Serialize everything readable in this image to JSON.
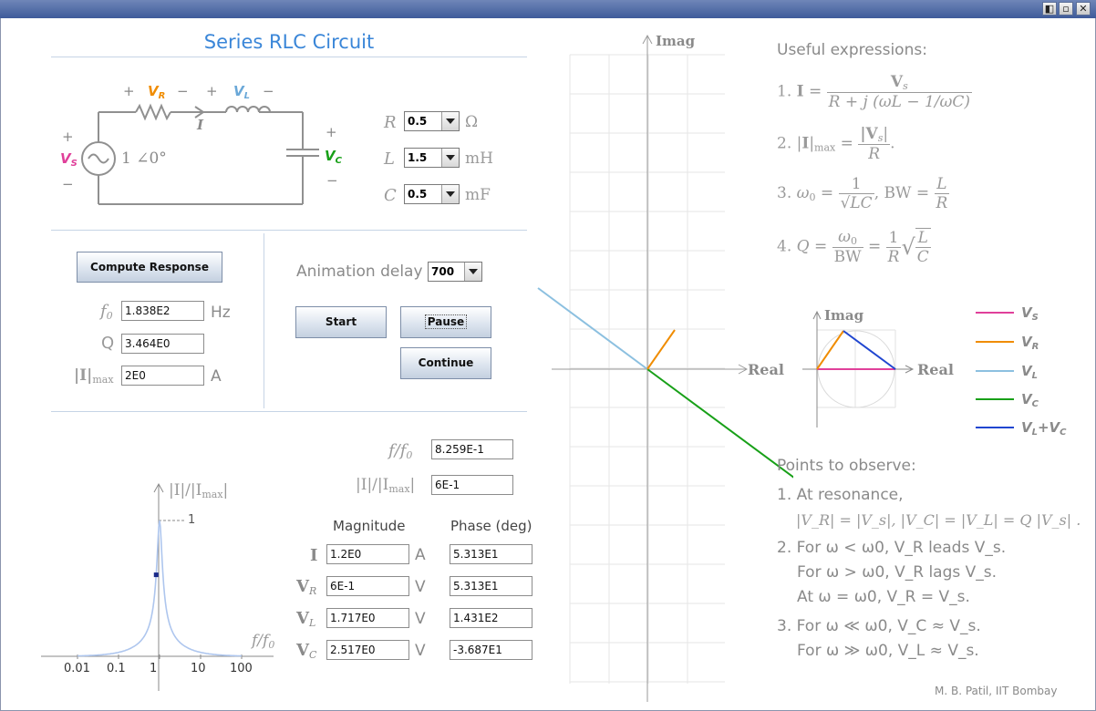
{
  "window": {
    "buttons": [
      "◧",
      "▫",
      "✕"
    ]
  },
  "app_title": "Series RLC Circuit",
  "circuit": {
    "source_value": "1 ∠0°",
    "current_label": "I",
    "plus": "+",
    "minus": "−",
    "vs_label": "V",
    "vs_sub": "S",
    "vr_label": "V",
    "vr_sub": "R",
    "vl_label": "V",
    "vl_sub": "L",
    "vc_label": "V",
    "vc_sub": "C",
    "colors": {
      "vs": "#e0409a",
      "vr": "#f08c00",
      "vl": "#6aa8d8",
      "vc": "#18a018",
      "vlvc": "#2046d0",
      "wire": "#909090"
    }
  },
  "params": {
    "r": {
      "label": "R",
      "value": "0.5",
      "unit": "Ω"
    },
    "l": {
      "label": "L",
      "value": "1.5",
      "unit": "mH"
    },
    "c": {
      "label": "C",
      "value": "0.5",
      "unit": "mF"
    }
  },
  "compute_button": "Compute Response",
  "results": {
    "f0": {
      "label": "f",
      "sub": "0",
      "value": "1.838E2",
      "unit": "Hz"
    },
    "q": {
      "label": "Q",
      "value": "3.464E0"
    },
    "imax": {
      "label": "|I|",
      "sub": "max",
      "value": "2E0",
      "unit": "A"
    }
  },
  "animation": {
    "label": "Animation delay",
    "delay": "700",
    "start": "Start",
    "pause": "Pause",
    "continue": "Continue"
  },
  "freq_plot": {
    "ylabel": "|I|/|I",
    "ylabel_sub": "max",
    "ylabel_end": "|",
    "xlabel": "f/f",
    "xlabel_sub": "0",
    "peak_label": "1",
    "ticks": [
      "0.01",
      "0.1",
      "1",
      "10",
      "100"
    ]
  },
  "chart_data": {
    "type": "line",
    "xlabel": "f/f0",
    "ylabel": "|I|/|Imax|",
    "x_scale": "log",
    "x_ticks": [
      0.01,
      0.1,
      1,
      10,
      100
    ],
    "peak": {
      "x": 1,
      "y": 1
    },
    "marker": {
      "x": 0.8259,
      "y": 0.6
    },
    "series": [
      {
        "values": [
          [
            0.01,
            0.01
          ],
          [
            0.1,
            0.03
          ],
          [
            0.3,
            0.07
          ],
          [
            0.6,
            0.15
          ],
          [
            0.8,
            0.5
          ],
          [
            1,
            1
          ],
          [
            1.25,
            0.5
          ],
          [
            1.7,
            0.15
          ],
          [
            3,
            0.07
          ],
          [
            10,
            0.03
          ],
          [
            100,
            0.01
          ]
        ]
      }
    ]
  },
  "point": {
    "f_ratio": {
      "label": "f/f",
      "sub": "0",
      "value": "8.259E-1"
    },
    "i_ratio": {
      "label": "|I|/|I",
      "sub": "max",
      "end": "|",
      "value": "6E-1"
    }
  },
  "table": {
    "col_mag": "Magnitude",
    "col_phase": "Phase (deg)",
    "rows": [
      {
        "label": "I",
        "sub": "",
        "mag": "1.2E0",
        "unit": "A",
        "phase": "5.313E1"
      },
      {
        "label": "V",
        "sub": "R",
        "mag": "6E-1",
        "unit": "V",
        "phase": "5.313E1"
      },
      {
        "label": "V",
        "sub": "L",
        "mag": "1.717E0",
        "unit": "V",
        "phase": "1.431E2"
      },
      {
        "label": "V",
        "sub": "C",
        "mag": "2.517E0",
        "unit": "V",
        "phase": "-3.687E1"
      }
    ]
  },
  "phasor": {
    "imag": "Imag",
    "real": "Real"
  },
  "expressions": {
    "title": "Useful expressions:",
    "e1_num": "V",
    "e1_num_sub": "s",
    "e1_den": "R + j (ωL − 1/ωC)",
    "e2_num": "|V",
    "e2_num_sub": "s",
    "e2_num_end": "|",
    "e2_den": "R",
    "e3_num": "1",
    "e3_den": "√LC",
    "e3_mid": ", BW =",
    "e3_num2": "L",
    "e3_den2": "R",
    "e4_num": "ω",
    "e4_num_sub": "0",
    "e4_den": "BW",
    "e4_mid": "=",
    "e4_num2": "1",
    "e4_den2": "R",
    "e4_sqrt_num": "L",
    "e4_sqrt_den": "C"
  },
  "legend": [
    {
      "label": "V",
      "sub": "S",
      "color": "#e0409a"
    },
    {
      "label": "V",
      "sub": "R",
      "color": "#f08c00"
    },
    {
      "label": "V",
      "sub": "L",
      "color": "#6aa8d8"
    },
    {
      "label": "V",
      "sub": "C",
      "color": "#18a018"
    },
    {
      "label": "V",
      "sub": "L",
      "extra": "+V",
      "extra_sub": "C",
      "color": "#2046d0"
    }
  ],
  "observe": {
    "title": "Points to observe:",
    "p1a": "1. At resonance,",
    "p1b": "|V_R| = |V_s|, |V_C| = |V_L| = Q |V_s| .",
    "p2a": "2. For ω < ω0,  V_R leads V_s.",
    "p2b": "For ω > ω0,  V_R lags V_s.",
    "p2c": "At ω = ω0,  V_R = V_s.",
    "p3a": "3. For ω ≪ ω0,  V_C ≈ V_s.",
    "p3b": "For ω ≫ ω0,  V_L ≈ V_s."
  },
  "footer": "M. B. Patil, IIT Bombay"
}
